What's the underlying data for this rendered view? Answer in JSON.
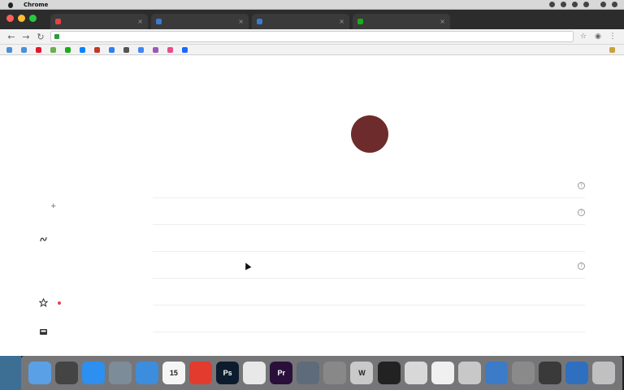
{
  "menubar": {
    "app": "Chrome",
    "items": [
      "",
      "",
      "",
      "",
      "",
      "",
      "",
      "",
      ""
    ],
    "clock": ""
  },
  "tabs": [
    {
      "title": "",
      "active": false,
      "color": "#e64340"
    },
    {
      "title": "",
      "active": false,
      "color": "#3a7bd5"
    },
    {
      "title": "",
      "active": false,
      "color": "#3a7bd5"
    },
    {
      "title": "",
      "active": true,
      "color": "#1aad19"
    }
  ],
  "toolbar": {
    "url": ""
  },
  "bookmarks": {
    "items": [
      {
        "label": "",
        "color": "#4a90d9"
      },
      {
        "label": "",
        "color": "#4a90d9"
      },
      {
        "label": "",
        "color": "#e6162d"
      },
      {
        "label": "",
        "color": "#6ab04c"
      },
      {
        "label": "",
        "color": "#1aad19"
      },
      {
        "label": "",
        "color": "#0084ff"
      },
      {
        "label": "",
        "color": "#c0392b"
      },
      {
        "label": "",
        "color": "#2f80ed"
      },
      {
        "label": "",
        "color": "#555555"
      },
      {
        "label": "",
        "color": "#4285f4"
      },
      {
        "label": "",
        "color": "#9b59b6"
      },
      {
        "label": "",
        "color": "#ea4c89"
      },
      {
        "label": "",
        "color": "#1769ff"
      }
    ],
    "other": ""
  },
  "sidebar": {
    "top_label": "",
    "items": [
      "",
      "",
      "",
      "",
      "",
      "",
      "",
      ""
    ],
    "add_plugin": "",
    "miniprogram": {
      "title": "",
      "items": [
        "",
        ""
      ]
    },
    "search": {
      "title": ""
    },
    "manage": {
      "title": "",
      "items": [
        ""
      ]
    }
  },
  "content": {
    "panel_title": "",
    "avatar_text": "",
    "avatar_caption": "",
    "rows": [
      {
        "key": "",
        "value": "",
        "action": "",
        "help": true,
        "muted": false
      },
      {
        "key": "",
        "value": "",
        "action": "",
        "help": true,
        "muted": false
      },
      {
        "key": "",
        "value": "",
        "action": "",
        "help": false,
        "muted": false
      },
      {
        "key": "",
        "value": "",
        "action": "",
        "help": true,
        "muted": false
      },
      {
        "key": "",
        "value": "",
        "action": "",
        "help": false,
        "muted": true
      },
      {
        "key": "",
        "value": "",
        "action": "",
        "help": false,
        "muted": true
      },
      {
        "key": "",
        "value": "",
        "action": "",
        "help": false,
        "muted": false
      }
    ],
    "right_float": ""
  },
  "dock": [
    {
      "name": "finder-icon",
      "glyph": "",
      "color": "#5aa0e6"
    },
    {
      "name": "launchpad-icon",
      "glyph": "",
      "color": "#444444"
    },
    {
      "name": "app-store-icon",
      "glyph": "",
      "color": "#2d8ff0"
    },
    {
      "name": "preview-icon",
      "glyph": "",
      "color": "#7d8c99"
    },
    {
      "name": "safari-icon",
      "glyph": "",
      "color": "#3c8dde"
    },
    {
      "name": "calendar-icon",
      "glyph": "15",
      "color": "#f5f5f5"
    },
    {
      "name": "app-icon",
      "glyph": "",
      "color": "#e33b2e"
    },
    {
      "name": "photoshop-icon",
      "glyph": "Ps",
      "color": "#0d1b2e"
    },
    {
      "name": "chrome-icon",
      "glyph": "",
      "color": "#e8e8e8"
    },
    {
      "name": "premiere-icon",
      "glyph": "Pr",
      "color": "#2a0f3a"
    },
    {
      "name": "keynote-icon",
      "glyph": "",
      "color": "#5d6b7a"
    },
    {
      "name": "app-icon",
      "glyph": "",
      "color": "#888888"
    },
    {
      "name": "wps-icon",
      "glyph": "W",
      "color": "#c9c9c9"
    },
    {
      "name": "qq-icon",
      "glyph": "",
      "color": "#222222"
    },
    {
      "name": "wechat-icon",
      "glyph": "",
      "color": "#d8d8d8"
    },
    {
      "name": "notes-icon",
      "glyph": "",
      "color": "#f0f0f0"
    },
    {
      "name": "app-icon",
      "glyph": "",
      "color": "#c8c8c8"
    },
    {
      "name": "app-icon",
      "glyph": "",
      "color": "#3b7bc8"
    },
    {
      "name": "system-preferences-icon",
      "glyph": "",
      "color": "#8a8a8a"
    },
    {
      "name": "quicktime-icon",
      "glyph": "",
      "color": "#3a3a3a"
    },
    {
      "name": "folder-icon",
      "glyph": "",
      "color": "#2e6fbf"
    },
    {
      "name": "trash-icon",
      "glyph": "",
      "color": "#c0c0c0"
    }
  ]
}
